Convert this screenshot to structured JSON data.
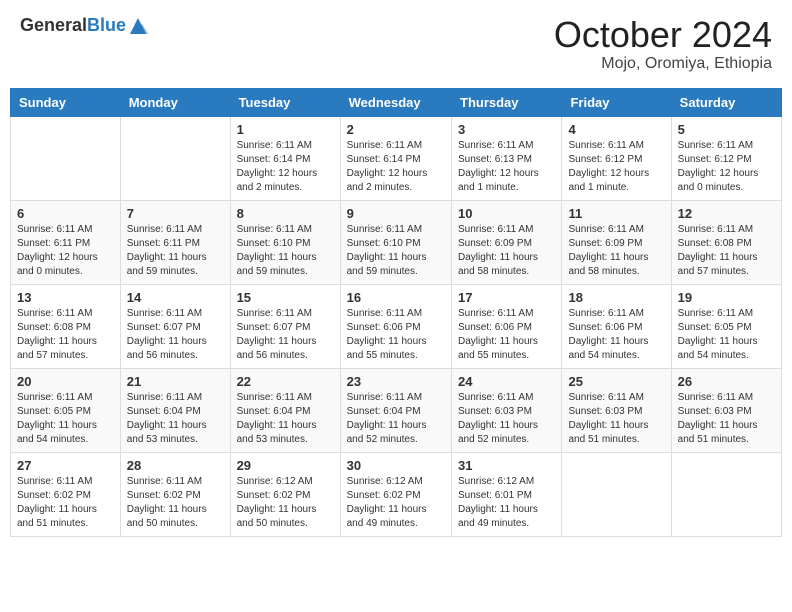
{
  "header": {
    "logo_general": "General",
    "logo_blue": "Blue",
    "title": "October 2024",
    "location": "Mojo, Oromiya, Ethiopia"
  },
  "days_of_week": [
    "Sunday",
    "Monday",
    "Tuesday",
    "Wednesday",
    "Thursday",
    "Friday",
    "Saturday"
  ],
  "weeks": [
    [
      {
        "day": "",
        "info": ""
      },
      {
        "day": "",
        "info": ""
      },
      {
        "day": "1",
        "info": "Sunrise: 6:11 AM\nSunset: 6:14 PM\nDaylight: 12 hours and 2 minutes."
      },
      {
        "day": "2",
        "info": "Sunrise: 6:11 AM\nSunset: 6:14 PM\nDaylight: 12 hours and 2 minutes."
      },
      {
        "day": "3",
        "info": "Sunrise: 6:11 AM\nSunset: 6:13 PM\nDaylight: 12 hours and 1 minute."
      },
      {
        "day": "4",
        "info": "Sunrise: 6:11 AM\nSunset: 6:12 PM\nDaylight: 12 hours and 1 minute."
      },
      {
        "day": "5",
        "info": "Sunrise: 6:11 AM\nSunset: 6:12 PM\nDaylight: 12 hours and 0 minutes."
      }
    ],
    [
      {
        "day": "6",
        "info": "Sunrise: 6:11 AM\nSunset: 6:11 PM\nDaylight: 12 hours and 0 minutes."
      },
      {
        "day": "7",
        "info": "Sunrise: 6:11 AM\nSunset: 6:11 PM\nDaylight: 11 hours and 59 minutes."
      },
      {
        "day": "8",
        "info": "Sunrise: 6:11 AM\nSunset: 6:10 PM\nDaylight: 11 hours and 59 minutes."
      },
      {
        "day": "9",
        "info": "Sunrise: 6:11 AM\nSunset: 6:10 PM\nDaylight: 11 hours and 59 minutes."
      },
      {
        "day": "10",
        "info": "Sunrise: 6:11 AM\nSunset: 6:09 PM\nDaylight: 11 hours and 58 minutes."
      },
      {
        "day": "11",
        "info": "Sunrise: 6:11 AM\nSunset: 6:09 PM\nDaylight: 11 hours and 58 minutes."
      },
      {
        "day": "12",
        "info": "Sunrise: 6:11 AM\nSunset: 6:08 PM\nDaylight: 11 hours and 57 minutes."
      }
    ],
    [
      {
        "day": "13",
        "info": "Sunrise: 6:11 AM\nSunset: 6:08 PM\nDaylight: 11 hours and 57 minutes."
      },
      {
        "day": "14",
        "info": "Sunrise: 6:11 AM\nSunset: 6:07 PM\nDaylight: 11 hours and 56 minutes."
      },
      {
        "day": "15",
        "info": "Sunrise: 6:11 AM\nSunset: 6:07 PM\nDaylight: 11 hours and 56 minutes."
      },
      {
        "day": "16",
        "info": "Sunrise: 6:11 AM\nSunset: 6:06 PM\nDaylight: 11 hours and 55 minutes."
      },
      {
        "day": "17",
        "info": "Sunrise: 6:11 AM\nSunset: 6:06 PM\nDaylight: 11 hours and 55 minutes."
      },
      {
        "day": "18",
        "info": "Sunrise: 6:11 AM\nSunset: 6:06 PM\nDaylight: 11 hours and 54 minutes."
      },
      {
        "day": "19",
        "info": "Sunrise: 6:11 AM\nSunset: 6:05 PM\nDaylight: 11 hours and 54 minutes."
      }
    ],
    [
      {
        "day": "20",
        "info": "Sunrise: 6:11 AM\nSunset: 6:05 PM\nDaylight: 11 hours and 54 minutes."
      },
      {
        "day": "21",
        "info": "Sunrise: 6:11 AM\nSunset: 6:04 PM\nDaylight: 11 hours and 53 minutes."
      },
      {
        "day": "22",
        "info": "Sunrise: 6:11 AM\nSunset: 6:04 PM\nDaylight: 11 hours and 53 minutes."
      },
      {
        "day": "23",
        "info": "Sunrise: 6:11 AM\nSunset: 6:04 PM\nDaylight: 11 hours and 52 minutes."
      },
      {
        "day": "24",
        "info": "Sunrise: 6:11 AM\nSunset: 6:03 PM\nDaylight: 11 hours and 52 minutes."
      },
      {
        "day": "25",
        "info": "Sunrise: 6:11 AM\nSunset: 6:03 PM\nDaylight: 11 hours and 51 minutes."
      },
      {
        "day": "26",
        "info": "Sunrise: 6:11 AM\nSunset: 6:03 PM\nDaylight: 11 hours and 51 minutes."
      }
    ],
    [
      {
        "day": "27",
        "info": "Sunrise: 6:11 AM\nSunset: 6:02 PM\nDaylight: 11 hours and 51 minutes."
      },
      {
        "day": "28",
        "info": "Sunrise: 6:11 AM\nSunset: 6:02 PM\nDaylight: 11 hours and 50 minutes."
      },
      {
        "day": "29",
        "info": "Sunrise: 6:12 AM\nSunset: 6:02 PM\nDaylight: 11 hours and 50 minutes."
      },
      {
        "day": "30",
        "info": "Sunrise: 6:12 AM\nSunset: 6:02 PM\nDaylight: 11 hours and 49 minutes."
      },
      {
        "day": "31",
        "info": "Sunrise: 6:12 AM\nSunset: 6:01 PM\nDaylight: 11 hours and 49 minutes."
      },
      {
        "day": "",
        "info": ""
      },
      {
        "day": "",
        "info": ""
      }
    ]
  ]
}
